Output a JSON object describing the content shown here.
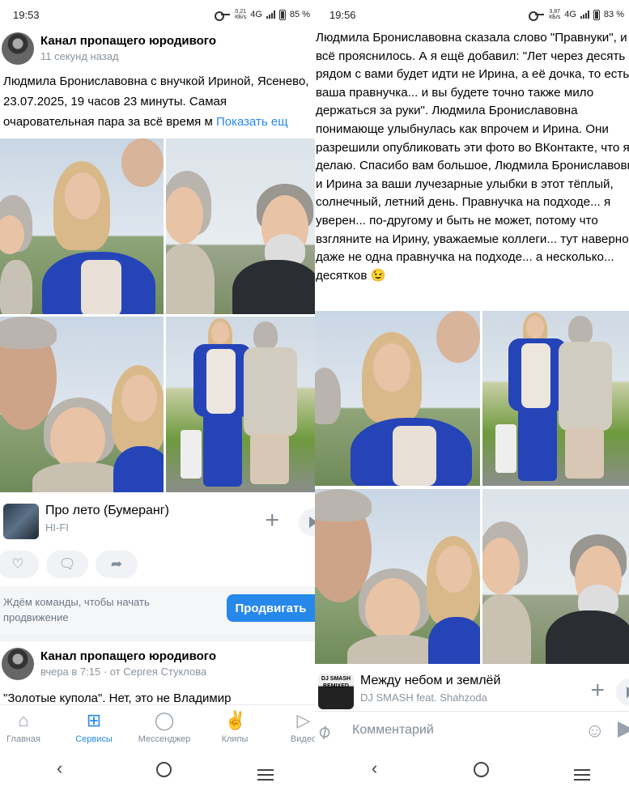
{
  "left": {
    "status": {
      "time": "19:53",
      "speed_value": "0,21",
      "speed_unit": "КБ/s",
      "network": "4G",
      "battery": "85 %"
    },
    "post": {
      "channel": "Канал пропащего юродивого",
      "time": "11 секунд назад",
      "text": "Людмила Брониславовна с внучкой Ириной, Ясенево, 23.07.2025, 19 часов 23 минуты. Самая очаровательная пара за всё время м",
      "more": "Показать ещ"
    },
    "music": {
      "title": "Про лето (Бумеранг)",
      "artist": "HI-FI"
    },
    "promo": {
      "text": "Ждём команды, чтобы начать продвижение",
      "button": "Продвигать"
    },
    "post2": {
      "channel": "Канал пропащего юродивого",
      "time": "вчера в 7:15 · от Сергея Стуклова",
      "text": "\"Золотые купола\". Нет, это не Владимир"
    },
    "tabs": [
      {
        "label": "Главная",
        "icon": "home-icon",
        "active": false
      },
      {
        "label": "Сервисы",
        "icon": "services-icon",
        "active": true
      },
      {
        "label": "Мессенджер",
        "icon": "messenger-icon",
        "active": false
      },
      {
        "label": "Клипы",
        "icon": "clips-icon",
        "active": false
      },
      {
        "label": "Видео",
        "icon": "video-icon",
        "active": false
      }
    ]
  },
  "right": {
    "status": {
      "time": "19:56",
      "speed_value": "3,87",
      "speed_unit": "КБ/s",
      "network": "4G",
      "battery": "83 %"
    },
    "text": "Людмила Брониславовна сказала слово \"Правнуки\", и всё прояснилось. А я ещё добавил: \"Лет через десять рядом с вами будет идти не Ирина, а её дочка, то есть ваша правнучка... и вы будете точно также мило держаться за руки\". Людмила Брониславовна понимающе улыбнулась как впрочем и Ирина. Они разрешили опубликовать эти фото во ВКонтакте, что я и делаю. Спасибо вам большое, Людмила Брониславовна и Ирина за ваши лучезарные улыбки в этот тёплый, солнечный, летний день. Правнучка на подходе... я уверен... по-другому и быть не может, потому что взгляните на Ирину, уважаемые коллеги... тут наверное даже не одна правнучка на подходе... а несколько... десятков 😉",
    "music": {
      "title": "Между небом и землёй",
      "artist": "DJ SMASH feat. Shahzoda",
      "cover_text": "DJ SMASH REMIXED"
    },
    "comment_placeholder": "Комментарий"
  },
  "colors": {
    "accent": "#2688eb",
    "muted": "#818c99",
    "bg_secondary": "#f0f2f5"
  }
}
